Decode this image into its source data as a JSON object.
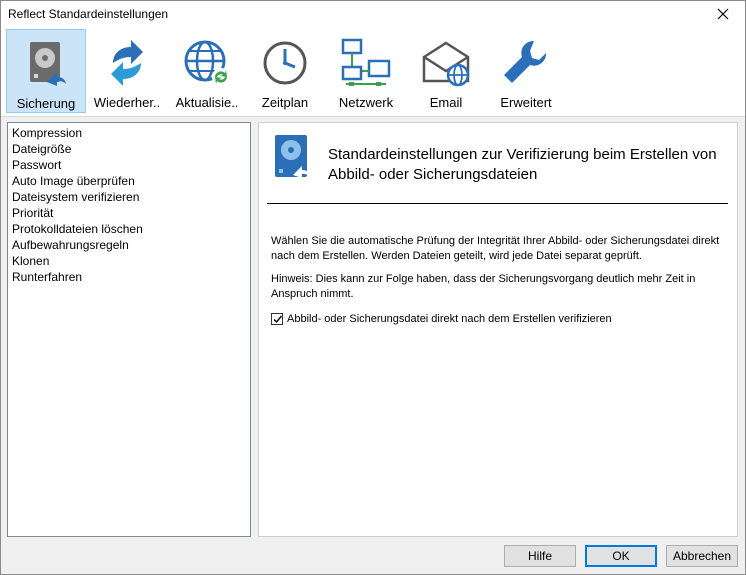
{
  "window": {
    "title": "Reflect Standardeinstellungen"
  },
  "toolbar": {
    "items": [
      {
        "label": "Sicherung",
        "icon": "hdd-backup-icon"
      },
      {
        "label": "Wiederher..",
        "icon": "restore-arrows-icon"
      },
      {
        "label": "Aktualisie..",
        "icon": "globe-update-icon"
      },
      {
        "label": "Zeitplan",
        "icon": "clock-icon"
      },
      {
        "label": "Netzwerk",
        "icon": "network-icon"
      },
      {
        "label": "Email",
        "icon": "email-icon"
      },
      {
        "label": "Erweitert",
        "icon": "wrench-icon"
      }
    ]
  },
  "list": {
    "items": [
      "Kompression",
      "Dateigröße",
      "Passwort",
      "Auto Image überprüfen",
      "Dateisystem verifizieren",
      "Priorität",
      "Protokolldateien löschen",
      "Aufbewahrungsregeln",
      "Klonen",
      "Runterfahren"
    ]
  },
  "panel": {
    "heading_line1": "Standardeinstellungen zur Verifizierung beim Erstellen von",
    "heading_line2": "Abbild- oder Sicherungsdateien",
    "para1_line1": "Wählen Sie die automatische Prüfung der Integrität Ihrer Abbild- oder Sicherungsdatei direkt",
    "para1_line2": "nach dem Erstellen. Werden Dateien geteilt, wird jede Datei separat geprüft.",
    "para2_line1": "Hinweis: Dies kann zur Folge haben, dass der Sicherungsvorgang deutlich mehr Zeit in",
    "para2_line2": "Anspruch nimmt.",
    "checkbox_label": "Abbild- oder Sicherungsdatei direkt nach dem Erstellen verifizieren"
  },
  "buttons": {
    "help": "Hilfe",
    "ok": "OK",
    "cancel": "Abbrechen"
  },
  "colors": {
    "accent": "#0078d7",
    "icon_blue": "#2a6fb8",
    "selection": "#cce4f7"
  }
}
